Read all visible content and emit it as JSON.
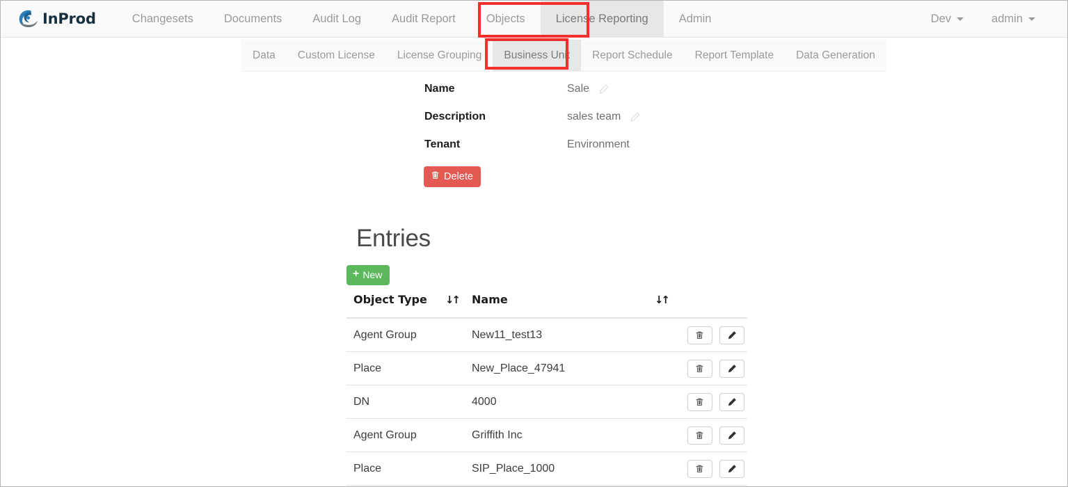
{
  "brand": {
    "name": "InProd",
    "logo_icon": "spiral-logo-icon"
  },
  "navbar": {
    "items": [
      {
        "label": "Changesets",
        "active": false
      },
      {
        "label": "Documents",
        "active": false
      },
      {
        "label": "Audit Log",
        "active": false
      },
      {
        "label": "Audit Report",
        "active": false
      },
      {
        "label": "Objects",
        "active": false
      },
      {
        "label": "License Reporting",
        "active": true
      },
      {
        "label": "Admin",
        "active": false
      }
    ],
    "right": [
      {
        "label": "Dev",
        "caret": true
      },
      {
        "label": "admin",
        "caret": true
      }
    ]
  },
  "subnav": {
    "items": [
      {
        "label": "Data",
        "active": false
      },
      {
        "label": "Custom License",
        "active": false
      },
      {
        "label": "License Grouping",
        "active": false
      },
      {
        "label": "Business Unit",
        "active": true
      },
      {
        "label": "Report Schedule",
        "active": false
      },
      {
        "label": "Report Template",
        "active": false
      },
      {
        "label": "Data Generation",
        "active": false
      }
    ]
  },
  "annotations": {
    "accent_color": "#f5302c",
    "boxes": [
      {
        "target": "License Reporting"
      },
      {
        "target": "Business Unit"
      }
    ]
  },
  "detail": {
    "fields": [
      {
        "label": "Name",
        "value": "Sale",
        "editable": true
      },
      {
        "label": "Description",
        "value": "sales team",
        "editable": true
      },
      {
        "label": "Tenant",
        "value": "Environment",
        "editable": false
      }
    ],
    "delete_button": {
      "label": "Delete",
      "icon": "trash-icon",
      "color": "#e45a52"
    }
  },
  "entries": {
    "title": "Entries",
    "new_button": {
      "label": "New",
      "icon": "plus-icon",
      "color": "#5cb85c"
    },
    "table": {
      "columns": [
        {
          "label": "Object Type",
          "sortable": true,
          "sort_icon": "sort-updown-icon"
        },
        {
          "label": "Name",
          "sortable": true,
          "sort_icon": "sort-updown-icon"
        },
        {
          "label": "",
          "sortable": false
        }
      ],
      "rows": [
        {
          "object_type": "Agent Group",
          "name": "New11_test13"
        },
        {
          "object_type": "Place",
          "name": "New_Place_47941"
        },
        {
          "object_type": "DN",
          "name": "4000"
        },
        {
          "object_type": "Agent Group",
          "name": "Griffith Inc"
        },
        {
          "object_type": "Place",
          "name": "SIP_Place_1000"
        }
      ],
      "row_actions": [
        {
          "icon": "trash-icon",
          "name": "delete-row-button"
        },
        {
          "icon": "pencil-icon",
          "name": "edit-row-button"
        }
      ]
    }
  }
}
